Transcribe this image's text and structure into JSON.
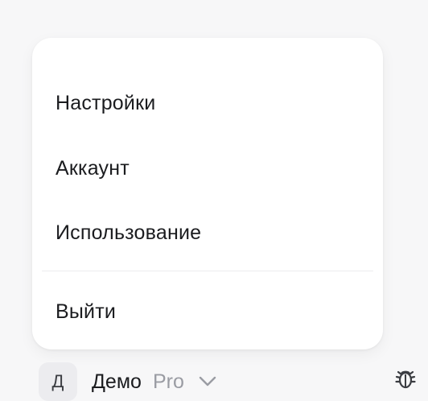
{
  "menu": {
    "items": [
      {
        "label": "Настройки"
      },
      {
        "label": "Аккаунт"
      },
      {
        "label": "Использование"
      },
      {
        "label": "Выйти"
      }
    ]
  },
  "footer": {
    "avatar_letter": "Д",
    "user_name": "Демо",
    "plan": "Pro",
    "dropdown_icon": "chevron-down-icon",
    "debug_icon": "bug-icon"
  },
  "colors": {
    "background": "#f7f7f8",
    "menu_background": "#ffffff",
    "text": "#1b1c1f",
    "muted": "#9a9ca3"
  }
}
